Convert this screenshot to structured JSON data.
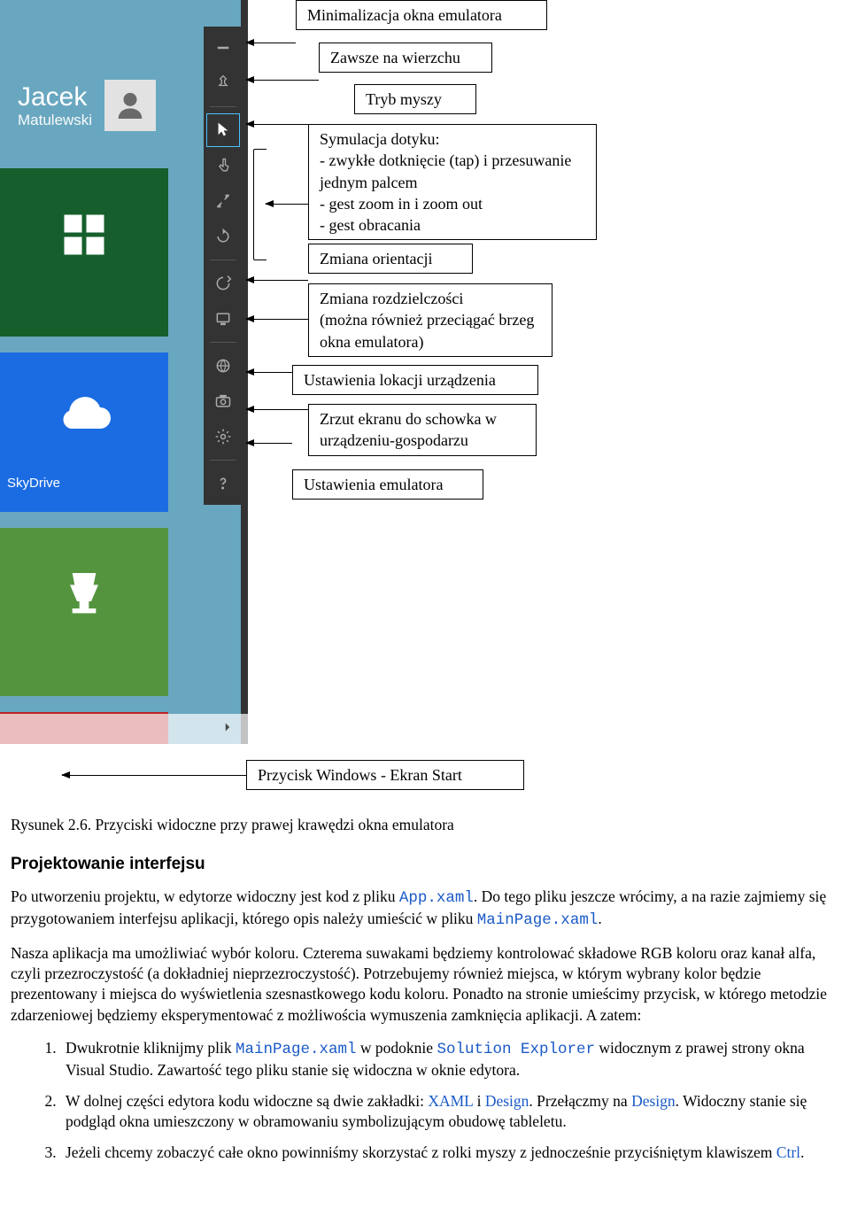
{
  "emulator": {
    "user_first": "Jacek",
    "user_last": "Matulewski",
    "tiles": {
      "skydrive_label": "SkyDrive"
    }
  },
  "callouts": {
    "minimize": "Minimalizacja okna emulatora",
    "topmost": "Zawsze na wierzchu",
    "mouse_mode": "Tryb myszy",
    "touch_sim": "Symulacja dotyku:\n- zwykłe dotknięcie (tap) i przesuwanie jednym palcem\n- gest zoom in i zoom out\n- gest obracania",
    "orientation": "Zmiana orientacji",
    "resolution": "Zmiana rozdzielczości\n(można również przeciągać brzeg okna emulatora)",
    "location": "Ustawienia lokacji urządzenia",
    "screenshot": "Zrzut ekranu do schowka w urządzeniu-gospodarzu",
    "settings": "Ustawienia emulatora",
    "windows_key": "Przycisk Windows - Ekran Start"
  },
  "figure_caption": "Rysunek 2.6. Przyciski widoczne przy prawej krawędzi okna emulatora",
  "section_heading": "Projektowanie interfejsu",
  "body": {
    "p1a": "Po utworzeniu projektu, w edytorze widoczny jest kod z pliku ",
    "p1b": ". Do tego pliku jeszcze wrócimy, a na razie zajmiemy się przygotowaniem interfejsu aplikacji, którego opis należy umieścić w pliku ",
    "p1c": ".",
    "app_xaml": "App.xaml",
    "mainpage_xaml": "MainPage.xaml",
    "p2": "Nasza aplikacja ma umożliwiać wybór koloru. Czterema suwakami będziemy kontrolować składowe RGB koloru oraz kanał alfa, czyli przezroczystość (a dokładniej nieprzezroczystość). Potrzebujemy również miejsca, w którym wybrany kolor będzie prezentowany i miejsca do wyświetlenia szesnastkowego kodu koloru. Ponadto na stronie umieścimy przycisk, w którego metodzie zdarzeniowej będziemy eksperymentować z możliwościa wymuszenia zamknięcia aplikacji. A zatem:"
  },
  "steps": {
    "s1a": "Dwukrotnie kliknijmy plik ",
    "s1b": " w podoknie ",
    "s1c": " widocznym z prawej strony okna Visual Studio. Zawartość tego pliku stanie się widoczna w oknie edytora.",
    "solution_explorer": "Solution Explorer",
    "s2a": "W dolnej części edytora kodu widoczne są dwie zakładki: ",
    "s2b": " i ",
    "s2c": ". Przełączmy na ",
    "s2d": ". Widoczny stanie się podgląd okna umieszczony w obramowaniu symbolizującym obudowę tableletu.",
    "xaml": "XAML",
    "design": "Design",
    "s3a": "Jeżeli chcemy zobaczyć całe okno powinniśmy skorzystać z rolki myszy z jednocześnie przyciśniętym klawiszem ",
    "s3b": ".",
    "ctrl": "Ctrl"
  }
}
